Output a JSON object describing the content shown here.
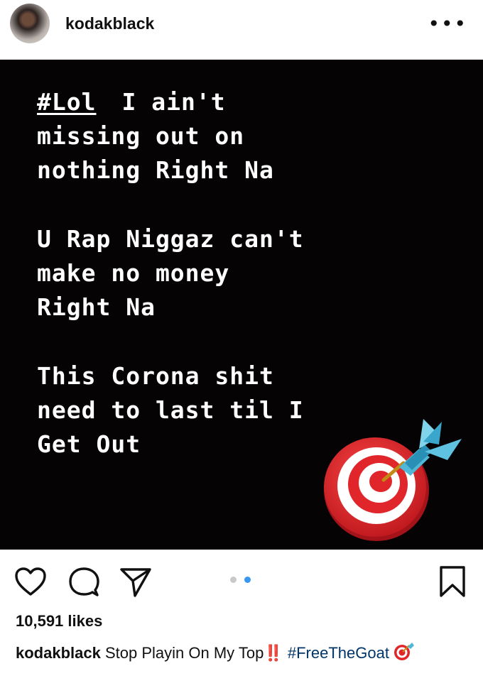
{
  "header": {
    "username": "kodakblack",
    "more_icon": "more-options-icon"
  },
  "post": {
    "hashtag": "#Lol",
    "line1_rest": "I ain't",
    "line2": "missing out on",
    "line3": "nothing Right Na",
    "line4": "U Rap Niggaz can't",
    "line5": "make no money",
    "line6": "Right Na",
    "line7": "This Corona shit",
    "line8": "need to last til I",
    "line9": "Get Out",
    "sticker": "direct-hit-target-icon"
  },
  "actions": {
    "like_icon": "heart-icon",
    "comment_icon": "comment-icon",
    "share_icon": "send-icon",
    "save_icon": "bookmark-icon",
    "carousel_dots": 2,
    "carousel_active": 2
  },
  "likes": "10,591 likes",
  "caption": {
    "user": "kodakblack",
    "text": "Stop Playin On My Top",
    "emphasis": "‼️",
    "hashtag": "#FreeTheGoat",
    "emoji": "direct-hit-target-icon"
  },
  "colors": {
    "post_bg": "#050303",
    "hashtag_link": "#003569",
    "carousel_active": "#3897f0"
  }
}
